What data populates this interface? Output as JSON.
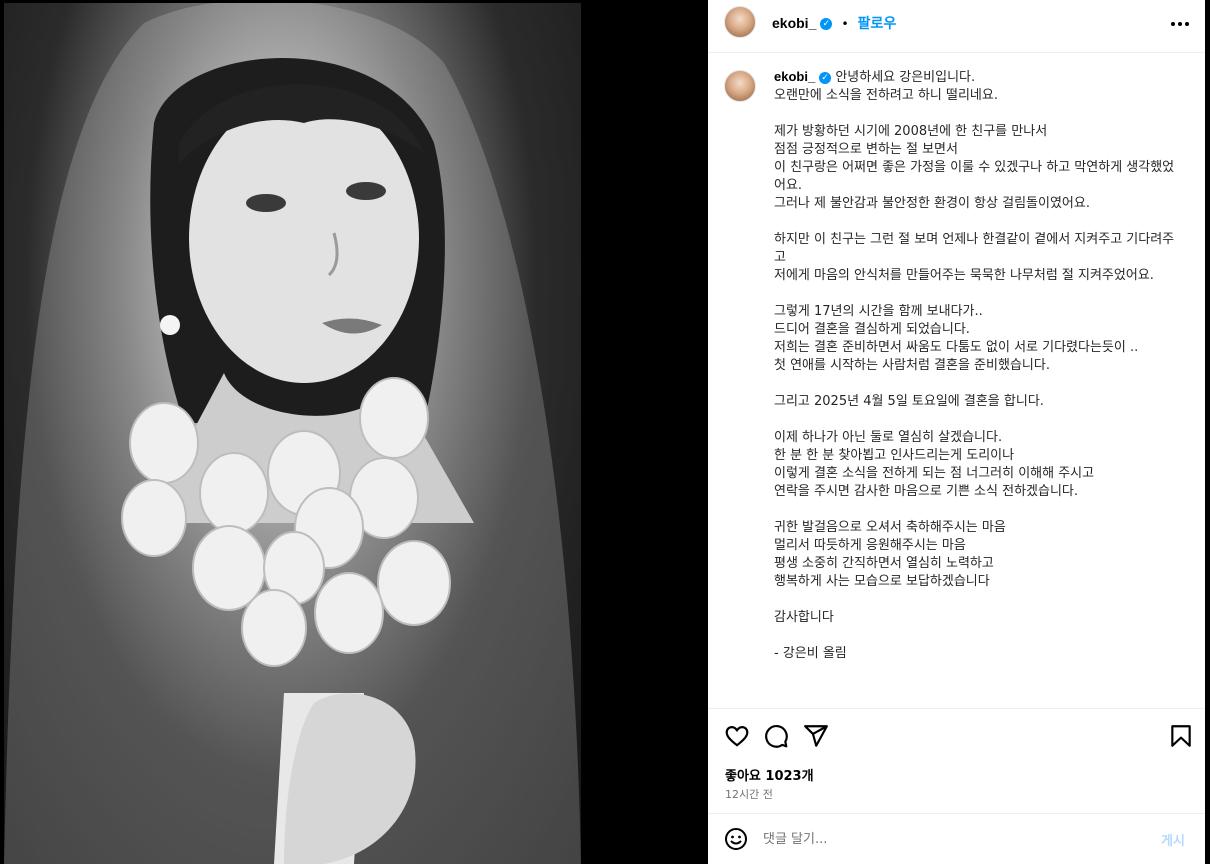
{
  "header": {
    "username": "ekobi_",
    "separator": "•",
    "follow_label": "팔로우",
    "more_icon": "more-horizontal-icon"
  },
  "caption": {
    "username": "ekobi_",
    "text": "안녕하세요 강은비입니다.\n오랜만에 소식을 전하려고 하니 떨리네요.\n\n제가 방황하던 시기에 2008년에 한 친구를 만나서\n점점 긍정적으로 변하는 절 보면서\n이 친구랑은 어쩌면 좋은 가정을 이룰 수 있겠구나 하고 막연하게 생각했었어요.\n그러나 제 불안감과 불안정한 환경이 항상 걸림돌이였어요.\n\n하지만 이 친구는 그런 절 보며 언제나 한결같이 곁에서 지켜주고 기다려주고\n저에게 마음의 안식처를 만들어주는 묵묵한 나무처럼 절 지켜주었어요.\n\n그렇게 17년의 시간을 함께 보내다가..\n드디어 결혼을 결심하게 되었습니다.\n저희는 결혼 준비하면서 싸움도 다툼도 없이 서로 기다렸다는듯이 ..\n첫 연애를 시작하는 사람처럼 결혼을 준비했습니다.\n\n그리고 2025년 4월 5일 토요일에 결혼을 합니다.\n\n이제 하나가 아닌 둘로 열심히 살겠습니다.\n한 분 한 분 찾아뵙고 인사드리는게 도리이나\n이렇게 결혼 소식을 전하게 되는 점 너그러히 이해해 주시고\n연락을 주시면 감사한 마음으로 기쁜 소식 전하겠습니다.\n\n귀한 발걸음으로 오셔서 축하해주시는 마음\n멀리서 따듯하게 응원해주시는 마음\n평생 소중히 간직하면서 열심히 노력하고\n행복하게 사는 모습으로 보답하겠습니다\n\n감사합니다\n\n- 강은비 올림"
  },
  "actions": {
    "like_icon": "heart-icon",
    "comment_icon": "comment-icon",
    "share_icon": "send-icon",
    "save_icon": "bookmark-icon",
    "likes_text": "좋아요 1023개",
    "time_text": "12시간 전"
  },
  "comment_bar": {
    "emoji_icon": "smiley-icon",
    "placeholder": "댓글 달기...",
    "post_label": "게시"
  },
  "colors": {
    "accent": "#0095f6",
    "post_disabled": "#b3dbff",
    "secondary_text": "#737373"
  }
}
